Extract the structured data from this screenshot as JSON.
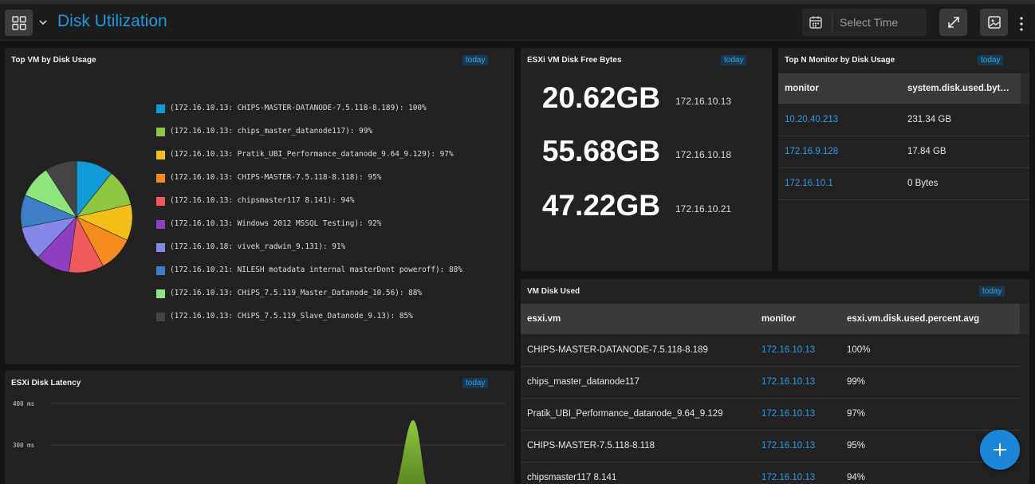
{
  "header": {
    "title": "Disk Utilization",
    "time_placeholder": "Select Time"
  },
  "colors": {
    "accent": "#1a9bdc",
    "badge_bg": "#173a52",
    "link": "#2e9be0"
  },
  "icons": [
    "grid-icon",
    "chevron-down-icon",
    "calendar-icon",
    "expand-icon",
    "image-icon",
    "kebab-menu-icon",
    "plus-icon"
  ],
  "top_vm": {
    "title": "Top VM by Disk Usage",
    "badge": "today",
    "legend": [
      {
        "label": "(172.16.10.13: CHIPS-MASTER-DATANODE-7.5.118-8.189): 100%",
        "color": "#0f9bd7"
      },
      {
        "label": "(172.16.10.13: chips_master_datanode117): 99%",
        "color": "#8dc63f"
      },
      {
        "label": "(172.16.10.13: Pratik_UBI_Performance_datanode_9.64_9.129): 97%",
        "color": "#f5bf1a"
      },
      {
        "label": "(172.16.10.13: CHIPS-MASTER-7.5.118-8.118): 95%",
        "color": "#f58a1f"
      },
      {
        "label": "(172.16.10.13: chipsmaster117 8.141): 94%",
        "color": "#ef5b5b"
      },
      {
        "label": "(172.16.10.13: Windows 2012 MSSQL Testing): 92%",
        "color": "#8e3fbf"
      },
      {
        "label": "(172.16.10.18: vivek_radwin_9.131): 91%",
        "color": "#8588e8"
      },
      {
        "label": "(172.16.10.21: NILESH motadata internal masterDont poweroff): 88%",
        "color": "#3d7fc7"
      },
      {
        "label": "(172.16.10.13: CHiPS_7.5.119_Master_Datanode_10.56): 88%",
        "color": "#8de67a"
      },
      {
        "label": "(172.16.10.13: CHiPS_7.5.119_Slave_Datanode_9.13): 85%",
        "color": "#444444"
      }
    ]
  },
  "chart_data": {
    "type": "pie",
    "categories": [
      "(172.16.10.13: CHIPS-MASTER-DATANODE-7.5.118-8.189)",
      "(172.16.10.13: chips_master_datanode117)",
      "(172.16.10.13: Pratik_UBI_Performance_datanode_9.64_9.129)",
      "(172.16.10.13: CHIPS-MASTER-7.5.118-8.118)",
      "(172.16.10.13: chipsmaster117 8.141)",
      "(172.16.10.13: Windows 2012 MSSQL Testing)",
      "(172.16.10.18: vivek_radwin_9.131)",
      "(172.16.10.21: NILESH motadata internal masterDont poweroff)",
      "(172.16.10.13: CHiPS_7.5.119_Master_Datanode_10.56)",
      "(172.16.10.13: CHiPS_7.5.119_Slave_Datanode_9.13)"
    ],
    "values": [
      100,
      99,
      97,
      95,
      94,
      92,
      91,
      88,
      88,
      85
    ],
    "colors": [
      "#0f9bd7",
      "#8dc63f",
      "#f5bf1a",
      "#f58a1f",
      "#ef5b5b",
      "#8e3fbf",
      "#8588e8",
      "#3d7fc7",
      "#8de67a",
      "#444444"
    ],
    "title": "Top VM by Disk Usage",
    "legend": "right"
  },
  "free_bytes": {
    "title": "ESXi VM Disk Free Bytes",
    "badge": "today",
    "rows": [
      {
        "value": "20.62GB",
        "ip": "172.16.10.13"
      },
      {
        "value": "55.68GB",
        "ip": "172.16.10.18"
      },
      {
        "value": "47.22GB",
        "ip": "172.16.10.21"
      }
    ]
  },
  "top_monitor": {
    "title": "Top N Monitor by Disk Usage",
    "badge": "today",
    "columns": [
      "monitor",
      "system.disk.used.bytes..."
    ],
    "rows": [
      [
        "10.20.40.213",
        "231.34 GB"
      ],
      [
        "172.16.9.128",
        "17.84 GB"
      ],
      [
        "172.16.10.1",
        "0 Bytes"
      ]
    ]
  },
  "vm_disk_used": {
    "title": "VM Disk Used",
    "badge": "today",
    "columns": [
      "esxi.vm",
      "monitor",
      "esxi.vm.disk.used.percent.avg"
    ],
    "rows": [
      [
        "CHIPS-MASTER-DATANODE-7.5.118-8.189",
        "172.16.10.13",
        "100%"
      ],
      [
        "chips_master_datanode117",
        "172.16.10.13",
        "99%"
      ],
      [
        "Pratik_UBI_Performance_datanode_9.64_9.129",
        "172.16.10.13",
        "97%"
      ],
      [
        "CHIPS-MASTER-7.5.118-8.118",
        "172.16.10.13",
        "95%"
      ],
      [
        "chipsmaster117 8.141",
        "172.16.10.13",
        "94%"
      ]
    ]
  },
  "latency": {
    "title": "ESXi Disk Latency",
    "badge": "today",
    "y_ticks": [
      "400 ms",
      "300 ms"
    ],
    "series_color": "#7fbf3f"
  }
}
